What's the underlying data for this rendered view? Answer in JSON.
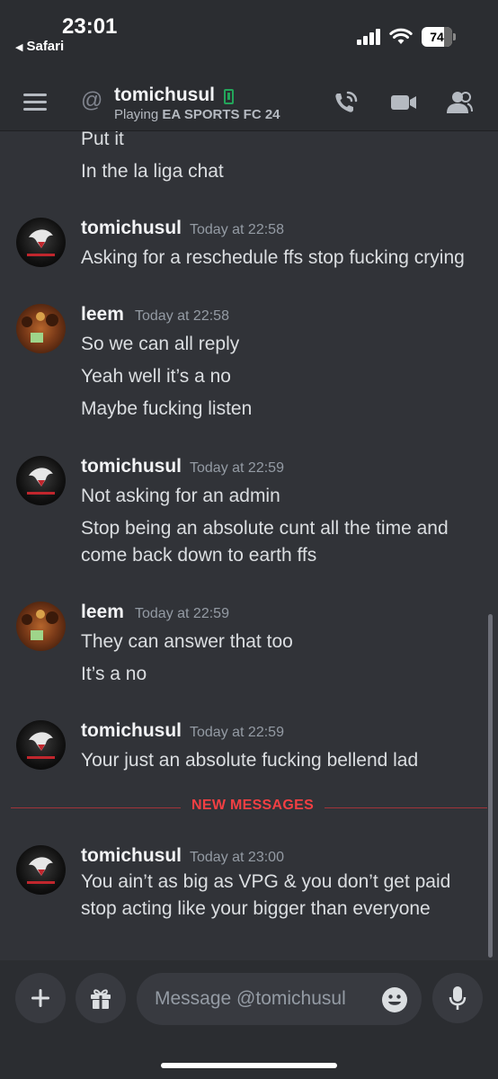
{
  "status_bar": {
    "time": "23:01",
    "back_app": "Safari",
    "battery": "74"
  },
  "header": {
    "title": "tomichusul",
    "activity_prefix": "Playing",
    "activity_game": "EA SPORTS FC 24"
  },
  "messages": {
    "continued": [
      "Put it",
      "In the la liga chat"
    ],
    "groups": [
      {
        "author": "tomichusul",
        "time": "Today at 22:58",
        "lines": [
          "Asking for a reschedule ffs stop fucking crying"
        ]
      },
      {
        "author": "leem",
        "time": "Today at 22:58",
        "lines": [
          "So we can all reply",
          "Yeah well it’s a no",
          "Maybe fucking listen"
        ]
      },
      {
        "author": "tomichusul",
        "time": "Today at 22:59",
        "lines": [
          "Not asking for an admin",
          "Stop being an absolute cunt all the time and",
          "come back down to earth ffs"
        ]
      },
      {
        "author": "leem",
        "time": "Today at 22:59",
        "lines": [
          "They can answer that too",
          "It’s a no"
        ]
      },
      {
        "author": "tomichusul",
        "time": "Today at 22:59",
        "lines": [
          "Your just an absolute fucking bellend lad"
        ]
      },
      {
        "author": "tomichusul",
        "time": "Today at 23:00",
        "lines": [
          "You ain’t as big as VPG & you don’t get paid",
          "stop acting like your bigger than everyone"
        ]
      }
    ],
    "new_messages_label": "NEW MESSAGES"
  },
  "composer": {
    "placeholder": "Message @tomichusul"
  },
  "colors": {
    "background": "#313338",
    "bar": "#2b2d31",
    "new_messages": "#f23f43",
    "online_mobile": "#23a55a"
  }
}
